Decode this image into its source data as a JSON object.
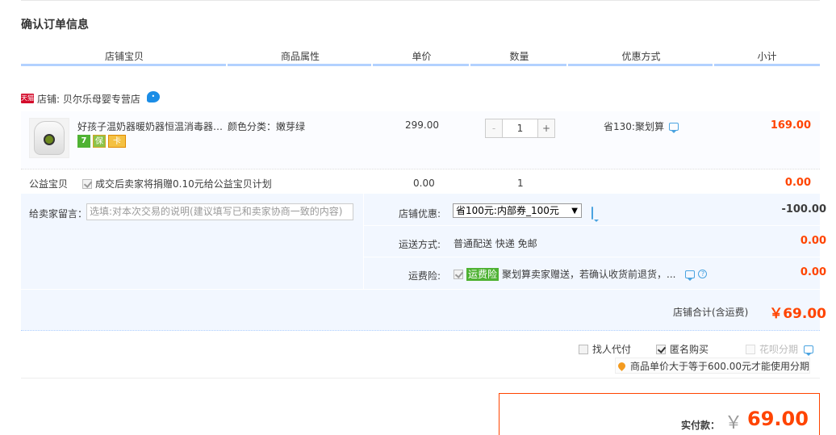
{
  "page_title": "确认订单信息",
  "columns": [
    "店铺宝贝",
    "商品属性",
    "单价",
    "数量",
    "优惠方式",
    "小计"
  ],
  "shop": {
    "badge": "天猫",
    "name": "店铺: 贝尔乐母婴专营店"
  },
  "item": {
    "title": "好孩子温奶器暖奶器恒温消毒器…",
    "attr": "颜色分类：嫩芽绿",
    "price": "299.00",
    "quantity": "1",
    "qty_minus": "-",
    "qty_plus": "+",
    "discount": "省130:聚划算",
    "subtotal": "169.00",
    "service_icons": [
      "7",
      "保",
      "卡"
    ]
  },
  "charity": {
    "label": "公益宝贝",
    "text": "成交后卖家将捐赠0.10元给公益宝贝计划",
    "price": "0.00",
    "quantity": "1",
    "subtotal": "0.00"
  },
  "order": {
    "message_label": "给卖家留言：",
    "message_placeholder": "选填:对本次交易的说明(建议填写已和卖家协商一致的内容)",
    "coupon_label": "店铺优惠:",
    "coupon_selected": "省100元:内部券_100元",
    "coupon_value": "-100.00",
    "shipping_label": "运送方式:",
    "shipping_text": "普通配送 快递 免邮",
    "shipping_value": "0.00",
    "insurance_label": "运费险:",
    "insurance_badge": "运费险",
    "insurance_text": "聚划算卖家赠送，若确认收货前退货，...",
    "insurance_value": "0.00",
    "shop_total_label": "店铺合计(含运费)",
    "shop_total_value": "￥69.00"
  },
  "options": {
    "proxy_pay": "找人代付",
    "anonymous": "匿名购买",
    "huabei": "花呗分期",
    "huabei_note": "商品单价大于等于600.00元才能使用分期"
  },
  "payment": {
    "label": "实付款：",
    "currency": "￥",
    "amount": "69.00"
  },
  "colors": {
    "accent": "#ff4400",
    "header_line": "#b2d1ff",
    "order_bg": "#f2f7ff"
  }
}
